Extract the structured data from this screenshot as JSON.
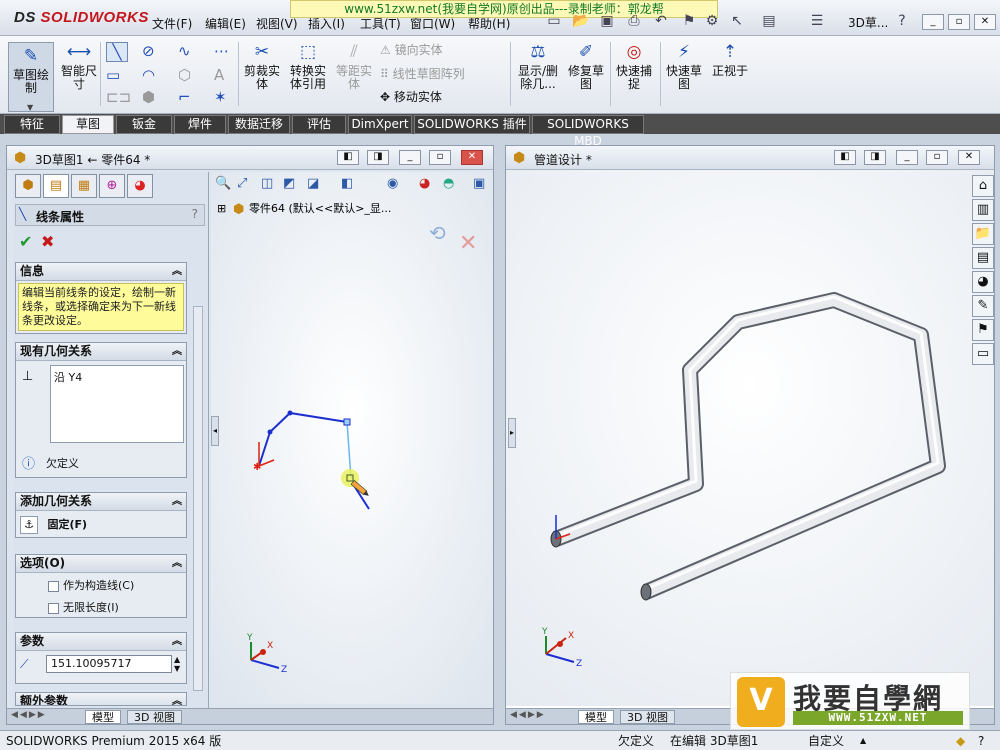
{
  "app": {
    "logo": "SOLIDWORKS",
    "logo_prefix": "DS"
  },
  "watermark": "www.51zxw.net(我要自学网)原创出品---录制老师：郭龙帮",
  "menu": [
    "文件(F)",
    "编辑(E)",
    "视图(V)",
    "插入(I)",
    "工具(T)",
    "窗口(W)",
    "帮助(H)"
  ],
  "toolbar_search": "3D草...",
  "commands": {
    "sketch": "草图绘制",
    "smart_dim": "智能尺寸",
    "trim": "剪裁实体",
    "convert": "转换实体引用",
    "offset": "等距实体",
    "mirror": "镜向实体",
    "pattern": "线性草图阵列",
    "move": "移动实体",
    "show_delete": "显示/删除几...",
    "repair": "修复草图",
    "snap": "快速捕捉",
    "quick_view": "快速草图",
    "normal_to": "正视于"
  },
  "tabs": [
    "特征",
    "草图",
    "钣金",
    "焊件",
    "数据迁移",
    "评估",
    "DimXpert",
    "SOLIDWORKS 插件",
    "SOLIDWORKS MBD"
  ],
  "active_tab": "草图",
  "left_window": {
    "title": "3D草图1 ← 零件64 *",
    "tree_item": "零件64 (默认<<默认>_显..."
  },
  "pm": {
    "title": "线条属性",
    "help": "?",
    "info_header": "信息",
    "info_text": "编辑当前线条的设定，绘制一新线条，或选择确定来为下一新线条更改设定。",
    "relations_header": "现有几何关系",
    "relation_item": "沿 Y4",
    "status": "欠定义",
    "add_relation_header": "添加几何关系",
    "fix_label": "固定(F)",
    "options_header": "选项(O)",
    "opt_construction": "作为构造线(C)",
    "opt_infinite": "无限长度(I)",
    "params_header": "参数",
    "length_value": "151.10095717",
    "extra_header": "额外参数"
  },
  "right_window": {
    "title": "管道设计 *"
  },
  "view_tabs": {
    "model": "模型",
    "view3d": "3D 视图"
  },
  "axes": {
    "x": "X",
    "y": "Y",
    "z": "Z"
  },
  "status": {
    "product": "SOLIDWORKS Premium 2015 x64 版",
    "state": "欠定义",
    "editing": "在编辑 3D草图1",
    "units": "自定义"
  },
  "brand": {
    "cn": "我要自學網",
    "url": "WWW.51ZXW.NET"
  }
}
